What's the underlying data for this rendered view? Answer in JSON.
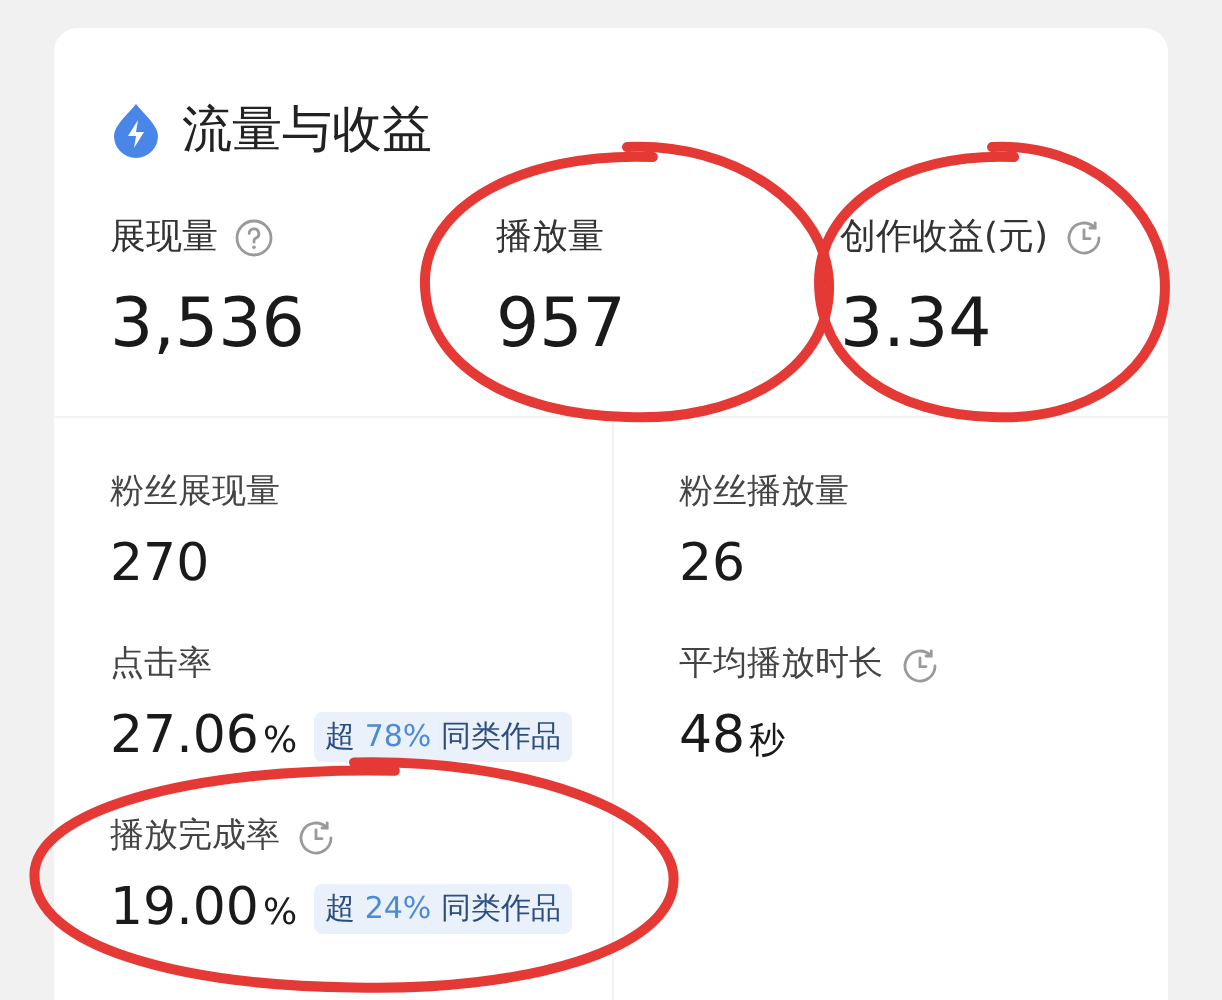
{
  "card": {
    "title": "流量与收益"
  },
  "top_stats": [
    {
      "label": "展现量",
      "help": true,
      "history": false,
      "value": "3,536",
      "circled": false
    },
    {
      "label": "播放量",
      "help": false,
      "history": false,
      "value": "957",
      "circled": true
    },
    {
      "label": "创作收益(元)",
      "help": false,
      "history": true,
      "value": "3.34",
      "circled": true
    }
  ],
  "detail_stats": [
    {
      "label": "粉丝展现量",
      "help": false,
      "history": false,
      "value": "270",
      "circled": false
    },
    {
      "label": "粉丝播放量",
      "help": false,
      "history": false,
      "value": "26",
      "circled": false
    },
    {
      "label": "点击率",
      "help": false,
      "history": false,
      "value": "27.06",
      "unit": "%",
      "badge": {
        "prefix": "超",
        "percent": "78%",
        "suffix": "同类作品"
      },
      "circled": false
    },
    {
      "label": "平均播放时长",
      "help": false,
      "history": true,
      "value": "48",
      "unit": "秒",
      "circled": false
    },
    {
      "label": "播放完成率",
      "help": false,
      "history": true,
      "value": "19.00",
      "unit": "%",
      "badge": {
        "prefix": "超",
        "percent": "24%",
        "suffix": "同类作品"
      },
      "circled": true
    }
  ]
}
